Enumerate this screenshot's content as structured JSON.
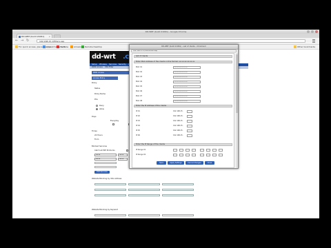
{
  "browser": {
    "window_title": "DD-WRT (build 21061) - Google Chrome",
    "tab_label": "DD-WRT (build 21061)",
    "address": "192.168.15.1/Filters.asp",
    "bookmarks": [
      "For quick access, place your bookmarks here",
      "Apps",
      "YouTube",
      "Amazon",
      "Remote Desktop"
    ],
    "other_bookmarks": "Other bookmarks"
  },
  "ddwrt": {
    "logo_text_1": "dd-wrt",
    "logo_text_2": ".com",
    "tabs": [
      "Setup",
      "Wireless",
      "Services",
      "Security",
      "Access Restrictions",
      "NAT / QoS",
      "Administration",
      "Status"
    ],
    "subtabs": [
      "WAN Access",
      "URL Filter"
    ],
    "section_title": "WAN Access",
    "section_title_2": "Access Policy",
    "labels": {
      "policy": "Policy",
      "status": "Status",
      "policy_name": "Policy Name",
      "pcs": "PCs",
      "deny": "Deny",
      "allow": "Allow",
      "days": "Days",
      "everyday": "Everyday",
      "times": "Times",
      "24_hours": "24 Hours",
      "from": "From",
      "blocked_services": "Blocked Services",
      "catch_all": "Catch all P2P Protocols",
      "website_blocking_url": "Website Blocking by URL Address",
      "website_blocking_keyword": "Website Blocking by Keyword"
    },
    "service_options": [
      "None",
      "None",
      "None",
      "None"
    ],
    "edit_services_button": "Edit Services"
  },
  "popup": {
    "title": "DD-WRT (build 21061) - List of clients - Chromium",
    "address": "192.168.15.1/FilterIPMAC.asp",
    "section_title": "List of clients",
    "mac_section_title": "Enter MAC Address of the clients in this format: xx:xx:xx:xx:xx:xx",
    "mac_rows": [
      {
        "label": "MAC 01",
        "value": "00:00:00:00:00:00"
      },
      {
        "label": "MAC 02",
        "value": "00:00:00:00:00:00"
      },
      {
        "label": "MAC 03",
        "value": "00:00:00:00:00:00"
      },
      {
        "label": "MAC 04",
        "value": "00:00:00:00:00:00"
      },
      {
        "label": "MAC 05",
        "value": "00:00:00:00:00:00"
      },
      {
        "label": "MAC 06",
        "value": "00:00:00:00:00:00"
      },
      {
        "label": "MAC 07",
        "value": "00:00:00:00:00:00"
      },
      {
        "label": "MAC 08",
        "value": "00:00:00:00:00:00"
      }
    ],
    "ip_section_title": "Enter the IP Address of the clients",
    "ip_rows": [
      {
        "label": "IP 01",
        "prefix": "192.168.15."
      },
      {
        "label": "IP 02",
        "prefix": "192.168.15."
      },
      {
        "label": "IP 03",
        "prefix": "192.168.15."
      },
      {
        "label": "IP 04",
        "prefix": "192.168.15."
      },
      {
        "label": "IP 05",
        "prefix": "192.168.15."
      },
      {
        "label": "IP 06",
        "prefix": "192.168.15."
      }
    ],
    "range_section_title": "Enter the IP Range of the clients",
    "range_rows": [
      {
        "label": "IP Range 01"
      },
      {
        "label": "IP Range 02"
      }
    ],
    "buttons": [
      "Save",
      "Apply Settings",
      "Cancel Changes",
      "Close"
    ]
  },
  "colors": {
    "dd_blue": "#1e4fa3",
    "section_blue": "#3e68b6",
    "button_blue": "#2f5fb3"
  }
}
